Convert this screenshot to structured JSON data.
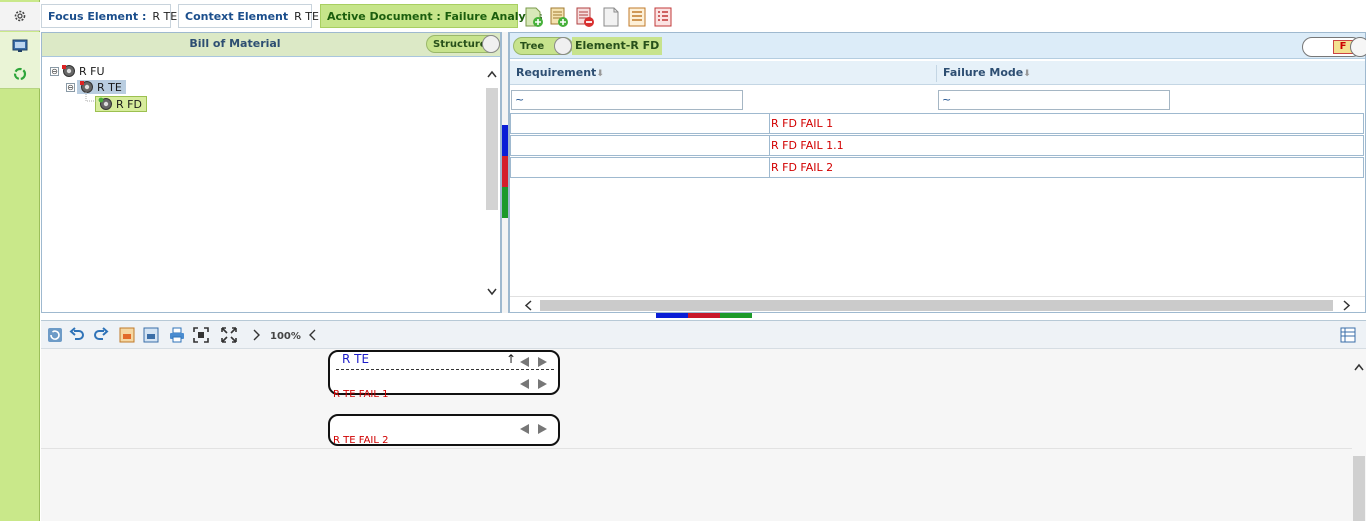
{
  "top": {
    "focus_label": "Focus Element :",
    "focus_value": "R TE",
    "context_label": "Context Element",
    "context_value": "R TE",
    "active_doc": "Active Document : Failure Analysis"
  },
  "bom": {
    "title": "Bill of Material",
    "toggle_label": "Structure",
    "tree": [
      {
        "label": "R FU",
        "expander": "⊖"
      },
      {
        "label": "R TE",
        "expander": "⊖"
      },
      {
        "label": "R FD",
        "expander": ""
      }
    ]
  },
  "fm": {
    "tree_toggle": "Tree",
    "element_label": "Element-R FD",
    "f_badge": "F",
    "columns": [
      "Requirement",
      "Failure Mode"
    ],
    "sort_glyph": "⬇",
    "filter_values": [
      "~",
      "~"
    ],
    "rows": [
      "R FD FAIL 1",
      "R FD FAIL 1.1",
      "R FD FAIL 2"
    ],
    "row_marker_colors": [
      "#0a1ed6",
      "#d4202a",
      "#1c9a2a"
    ]
  },
  "diagram": {
    "zoom": "100%",
    "node1_title": "R TE",
    "node1_fail": "R TE FAIL 1",
    "node2_fail": "R TE FAIL 2",
    "up_arrow": "↑"
  },
  "colors": {
    "rail": "#c9e88a",
    "accent_green": "#c6e58a",
    "fail_red": "#d00000",
    "link_blue": "#1b4e8c"
  }
}
